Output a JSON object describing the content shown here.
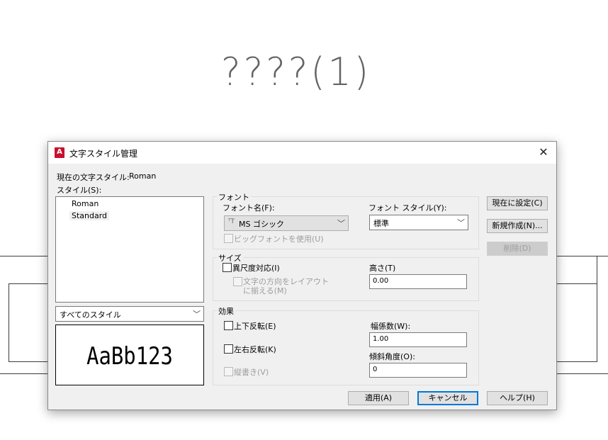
{
  "canvas": {
    "title_text": "????(1)"
  },
  "dialog": {
    "title": "文字スタイル管理",
    "app_icon": "A",
    "close_glyph": "✕",
    "current_style_label": "現在の文字スタイル:",
    "current_style_value": "Roman",
    "styles_label": "スタイル(S):",
    "styles": [
      "Roman",
      "Standard"
    ],
    "selected_style": "Standard",
    "filter_value": "すべてのスタイル",
    "preview_text": "AaBb123",
    "font": {
      "group_title": "フォント",
      "name_label": "フォント名(F):",
      "name_value": "MS ゴシック",
      "name_icon": "ᵀT",
      "style_label": "フォント スタイル(Y):",
      "style_value": "標準",
      "bigfont_label": "ビッグフォントを使用(U)"
    },
    "size": {
      "group_title": "サイズ",
      "annotative_label": "異尺度対応(I)",
      "orientation_label_line1": "文字の方向をレイアウト",
      "orientation_label_line2": "に揃える(M)",
      "height_label": "高さ(T)",
      "height_value": "0.00"
    },
    "effects": {
      "group_title": "効果",
      "upside_down_label": "上下反転(E)",
      "backwards_label": "左右反転(K)",
      "vertical_label": "縦書き(V)",
      "width_factor_label": "幅係数(W):",
      "width_factor_value": "1.00",
      "oblique_label": "傾斜角度(O):",
      "oblique_value": "0"
    },
    "buttons": {
      "set_current": "現在に設定(C)",
      "new": "新規作成(N)...",
      "delete": "削除(D)",
      "apply": "適用(A)",
      "cancel": "キャンセル",
      "help": "ヘルプ(H)"
    },
    "dropdown_arrow": "﹀"
  }
}
